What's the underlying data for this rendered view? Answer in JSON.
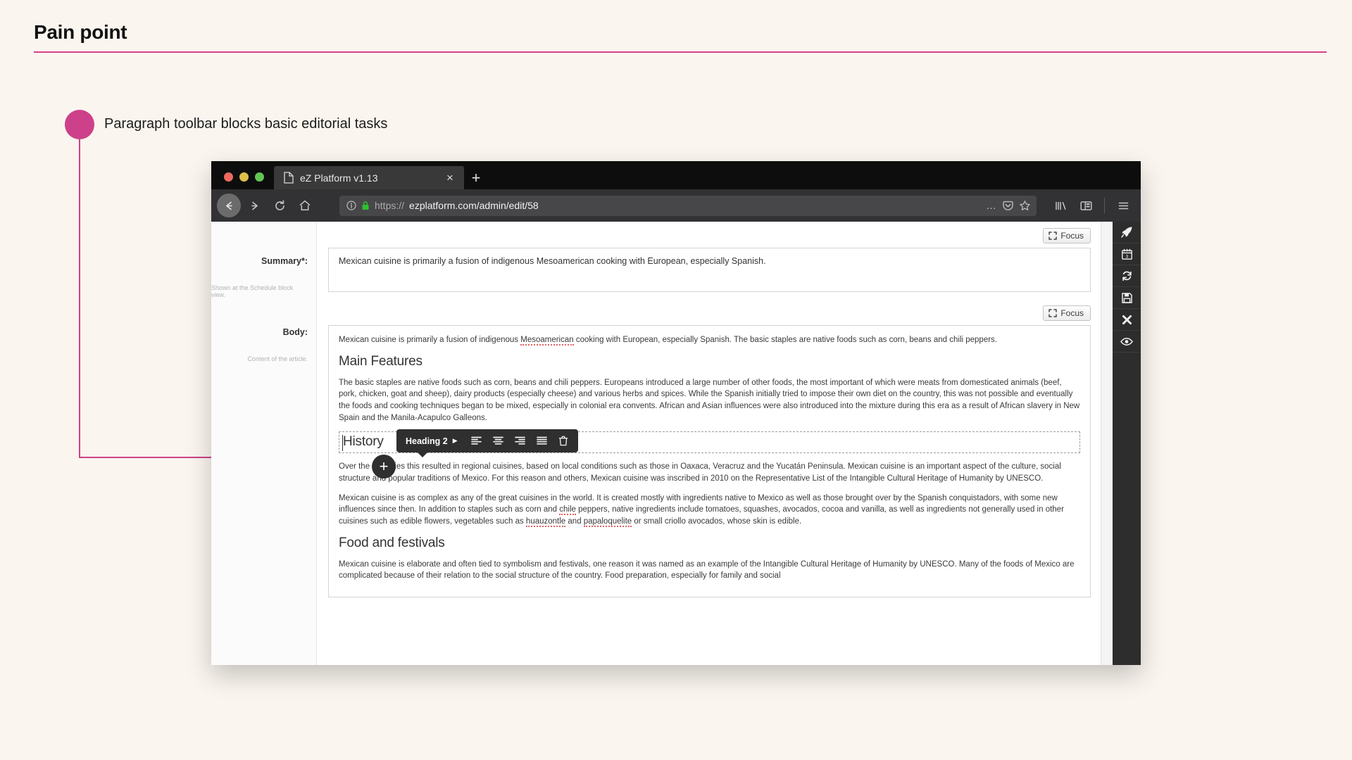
{
  "slide": {
    "title": "Pain point",
    "callout": "Paragraph toolbar blocks basic editorial tasks",
    "accent_color": "#cc4189",
    "background_color": "#faf5ef"
  },
  "browser": {
    "tab": {
      "title": "eZ Platform v1.13",
      "favicon": "document-icon",
      "close": "×"
    },
    "new_tab": "+",
    "nav": {
      "back": "←",
      "forward": "→",
      "reload": "↻",
      "home": "⌂"
    },
    "url": {
      "scheme": "https://",
      "host": "ezplatform.com/admin/edit/58",
      "info_icon": "info-icon",
      "lock_icon": "padlock-icon"
    },
    "toolbar_right": {
      "more": "…",
      "pocket": "pocket-icon",
      "bookmark": "star-icon",
      "library": "library-icon",
      "sidebar": "sidebar-icon",
      "menu": "hamburger-menu-icon"
    }
  },
  "form": {
    "summary_label": "Summary*:",
    "summary_hint": "Shown at the Schedule block view.",
    "body_label": "Body:",
    "body_hint": "Content of the article.",
    "focus_label": "Focus"
  },
  "summary_field": {
    "text": "Mexican cuisine is primarily a fusion of indigenous Mesoamerican cooking with European, especially Spanish."
  },
  "body_field": {
    "intro_a": "Mexican cuisine is primarily a fusion of indigenous ",
    "intro_misspelled": "Mesoamerican",
    "intro_b": " cooking with European, especially Spanish. The basic staples are native foods such as corn, beans and chili peppers.",
    "heading_main_features": "Main Features",
    "para_main_features": "The basic staples are native foods such as corn, beans and chili peppers. Europeans introduced a large number of other foods, the most important of which were meats from domesticated animals (beef, pork, chicken, goat and sheep), dairy products (especially cheese) and various herbs and spices. While the Spanish initially tried to impose their own diet on the country, this was not possible and eventually the foods and cooking techniques began to be mixed, especially in colonial era convents. African and Asian influences were also introduced into the mixture during this era as a result of African slavery in New Spain and the Manila-Acapulco Galleons.",
    "heading_history": "History",
    "para_history": "Over the centuries this resulted in regional cuisines, based on local conditions such as those in Oaxaca, Veracruz and the Yucatán Peninsula. Mexican cuisine is an important aspect of the culture, social structure and popular traditions of Mexico. For this reason and others, Mexican cuisine was inscribed in 2010 on the Representative List of the Intangible Cultural Heritage of Humanity by UNESCO.",
    "para_complex_a": "Mexican cuisine is as complex as any of the great cuisines in the world. It is created mostly with ingredients native to Mexico as well as those brought over by the Spanish conquistadors, with some new influences since then. In addition to staples such as corn and ",
    "para_complex_m1": "chile",
    "para_complex_b": " peppers, native ingredients include tomatoes, squashes, avocados, cocoa and vanilla, as well as ingredients not generally used in other cuisines such as edible flowers, vegetables such as ",
    "para_complex_m2": "huauzontle",
    "para_complex_c": " and ",
    "para_complex_m3": "papaloquelite",
    "para_complex_d": " or small criollo avocados, whose skin is edible.",
    "heading_food_festivals": "Food and festivals",
    "para_food_festivals": "Mexican cuisine is elaborate and often tied to symbolism and festivals, one reason it was named as an example of the Intangible Cultural Heritage of Humanity by UNESCO. Many of the foods of Mexico are complicated because of their relation to the social structure of the country. Food preparation, especially for family and social"
  },
  "paragraph_toolbar": {
    "style": "Heading 2",
    "caret": "▶",
    "buttons": [
      {
        "name": "align-left",
        "glyph": "align-left-icon"
      },
      {
        "name": "align-center",
        "glyph": "align-center-icon"
      },
      {
        "name": "align-right",
        "glyph": "align-right-icon"
      },
      {
        "name": "align-justify",
        "glyph": "align-justify-icon"
      },
      {
        "name": "delete-block",
        "glyph": "trash-icon"
      }
    ]
  },
  "add_block_button": "+",
  "app_rail": [
    {
      "name": "publish",
      "glyph": "rocket-icon"
    },
    {
      "name": "schedule",
      "glyph": "calendar-icon"
    },
    {
      "name": "refresh",
      "glyph": "refresh-icon"
    },
    {
      "name": "save",
      "glyph": "floppy-disk-icon"
    },
    {
      "name": "close",
      "glyph": "close-x-icon"
    },
    {
      "name": "preview",
      "glyph": "eye-icon"
    }
  ]
}
